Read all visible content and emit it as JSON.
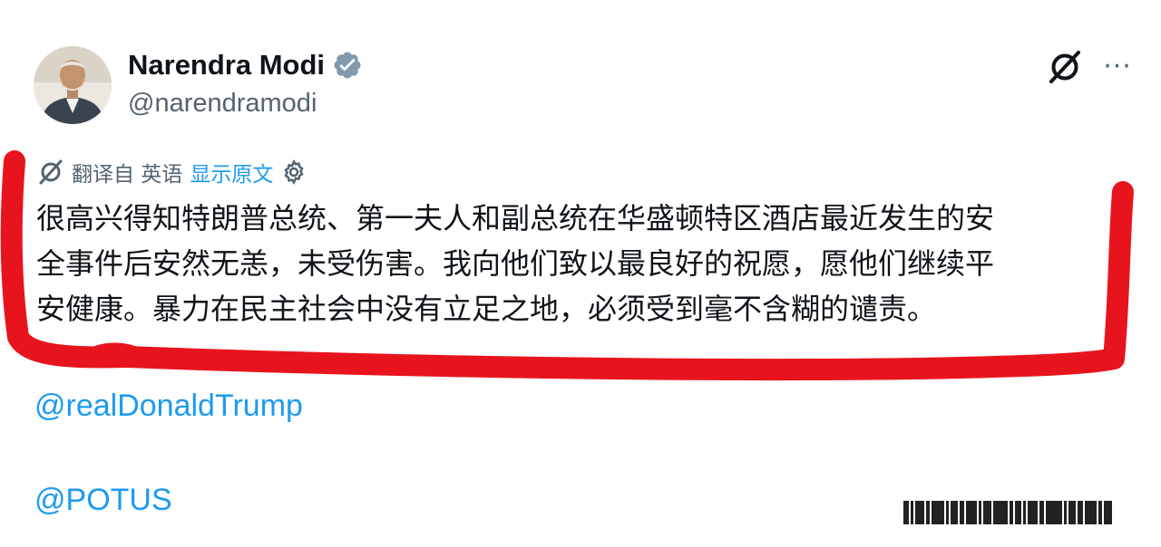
{
  "header": {
    "display_name": "Narendra Modi",
    "handle": "@narendramodi",
    "verified": true,
    "verified_icon": "verified-badge-icon",
    "grok_icon": "grok-icon",
    "more_icon": "more-options-icon",
    "more_glyph": "···"
  },
  "translation": {
    "icon": "grok-icon",
    "label": "翻译自 英语",
    "show_original": "显示原文",
    "settings_icon": "gear-icon"
  },
  "tweet": {
    "lines": [
      "很高兴得知特朗普总统、第一夫人和副总统在华盛顿特区酒店最近发生的安",
      "全事件后安然无恙，未受伤害。我向他们致以最良好的祝愿，愿他们继续平",
      "安健康。暴力在民主社会中没有立足之地，必须受到毫不含糊的谴责。"
    ]
  },
  "mentions": [
    "@realDonaldTrump",
    "@POTUS"
  ],
  "colors": {
    "text": "#0f1419",
    "secondary": "#536471",
    "link": "#1d9bf0",
    "annotation": "#e8141d",
    "badge": "#829aab"
  }
}
